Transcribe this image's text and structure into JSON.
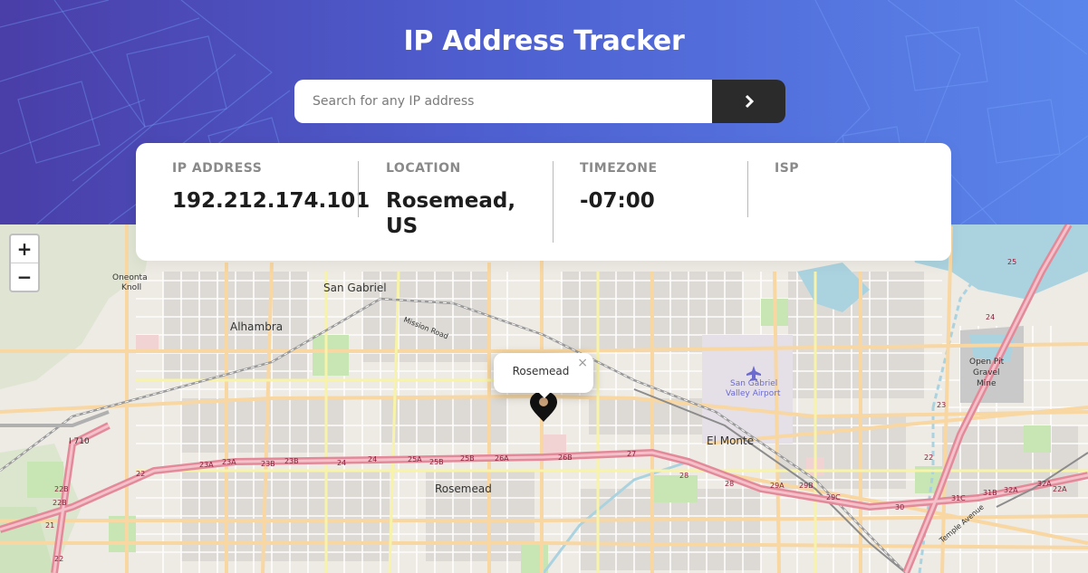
{
  "app": {
    "title": "IP Address Tracker"
  },
  "search": {
    "placeholder": "Search for any IP address",
    "value": "",
    "button_icon": "chevron-right-icon"
  },
  "info": {
    "ip": {
      "label": "IP ADDRESS",
      "value": "192.212.174.101"
    },
    "location": {
      "label": "LOCATION",
      "value_line1": "Rosemead,",
      "value_line2": "US"
    },
    "timezone": {
      "label": "TIMEZONE",
      "value": "-07:00"
    },
    "isp": {
      "label": "ISP",
      "value": ""
    }
  },
  "map": {
    "zoom_in": "+",
    "zoom_out": "−",
    "popup_text": "Rosemead",
    "popup_close": "×",
    "marker_icon": "location-pin-icon",
    "places": {
      "alhambra": "Alhambra",
      "san_gabriel": "San Gabriel",
      "rosemead": "Rosemead",
      "el_monte": "El Monte",
      "oneonta_1": "Oneonta",
      "oneonta_2": "Knoll",
      "airport_1": "San Gabriel",
      "airport_2": "Valley Airport",
      "pit_1": "Open Pit",
      "pit_2": "Gravel",
      "pit_3": "Mine",
      "mission_road": "Mission Road",
      "i710": "I 710",
      "temple_ave": "Temple Avenue"
    },
    "exits": {
      "e23a": "23A",
      "e23b": "23B",
      "e23b2": "23B",
      "e24": "24",
      "e25a": "25A",
      "e25b": "25B",
      "e25b2": "25B",
      "e26a": "26A",
      "e26b": "26B",
      "e27": "27",
      "e28": "28",
      "e28b": "28",
      "e29a": "29A",
      "e29b": "29B",
      "e29c": "29C",
      "e30": "30",
      "e31c": "31C",
      "e31b": "31B",
      "e32a": "32A",
      "e32a2": "32A",
      "e22": "22",
      "e22b": "22B",
      "e22a": "22A",
      "e21": "21",
      "e22c": "22",
      "e24n": "24",
      "e25n": "25",
      "e23n": "23",
      "e22n": "22"
    },
    "colors": {
      "land": "#eeeae4",
      "freeway": "#e8a3b0",
      "major": "#f8d7a2",
      "minor": "#ffffff",
      "water": "#abd3df",
      "park": "#c8e6b4"
    }
  }
}
